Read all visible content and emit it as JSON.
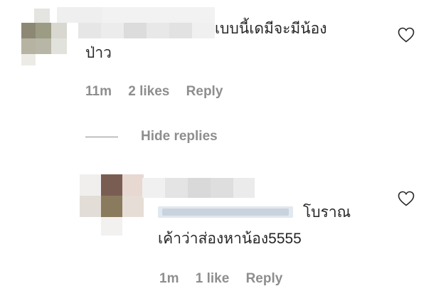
{
  "comment": {
    "text_line1": "เบบนี้เดมีจะมีน้อง",
    "text_line2": "ป่าว",
    "time": "11m",
    "likes": "2 likes",
    "reply_label": "Reply"
  },
  "hide_replies_label": "Hide replies",
  "reply": {
    "text_line1": "โบราณ",
    "text_line2": "เค้าว่าส่องหาน้อง5555",
    "time": "1m",
    "likes": "1 like",
    "reply_label": "Reply"
  },
  "colors": {
    "meta_gray": "#8e8e8e",
    "text": "#262626",
    "mention_blue": "#dbe6f2"
  },
  "icons": [
    "heart-icon",
    "heart-icon"
  ]
}
